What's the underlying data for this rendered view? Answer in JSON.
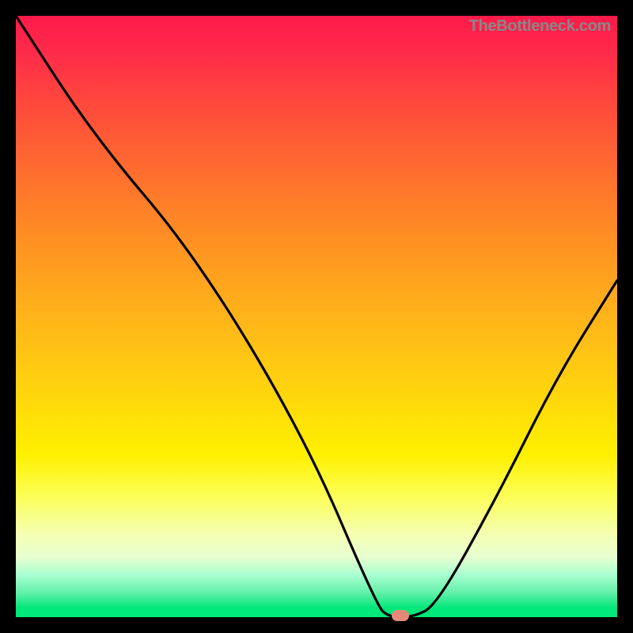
{
  "attribution": "TheBottleneck.com",
  "chart_data": {
    "type": "line",
    "title": "",
    "xlabel": "",
    "ylabel": "",
    "xlim": [
      0,
      100
    ],
    "ylim": [
      0,
      100
    ],
    "background": "heat-gradient",
    "series": [
      {
        "name": "bottleneck-curve",
        "x": [
          0,
          13,
          30,
          48,
          60,
          62,
          66,
          70,
          80,
          90,
          100
        ],
        "values": [
          100,
          80,
          60,
          30,
          2,
          0,
          0,
          2,
          20,
          40,
          56
        ]
      }
    ],
    "marker": {
      "x": 64,
      "y": 0,
      "shape": "rounded-rect",
      "color": "#e58a7a"
    },
    "colors": {
      "top": "#ff1a4a",
      "mid": "#fff000",
      "bottom": "#00e77a",
      "curve": "#000000",
      "background_outer": "#000000"
    }
  }
}
